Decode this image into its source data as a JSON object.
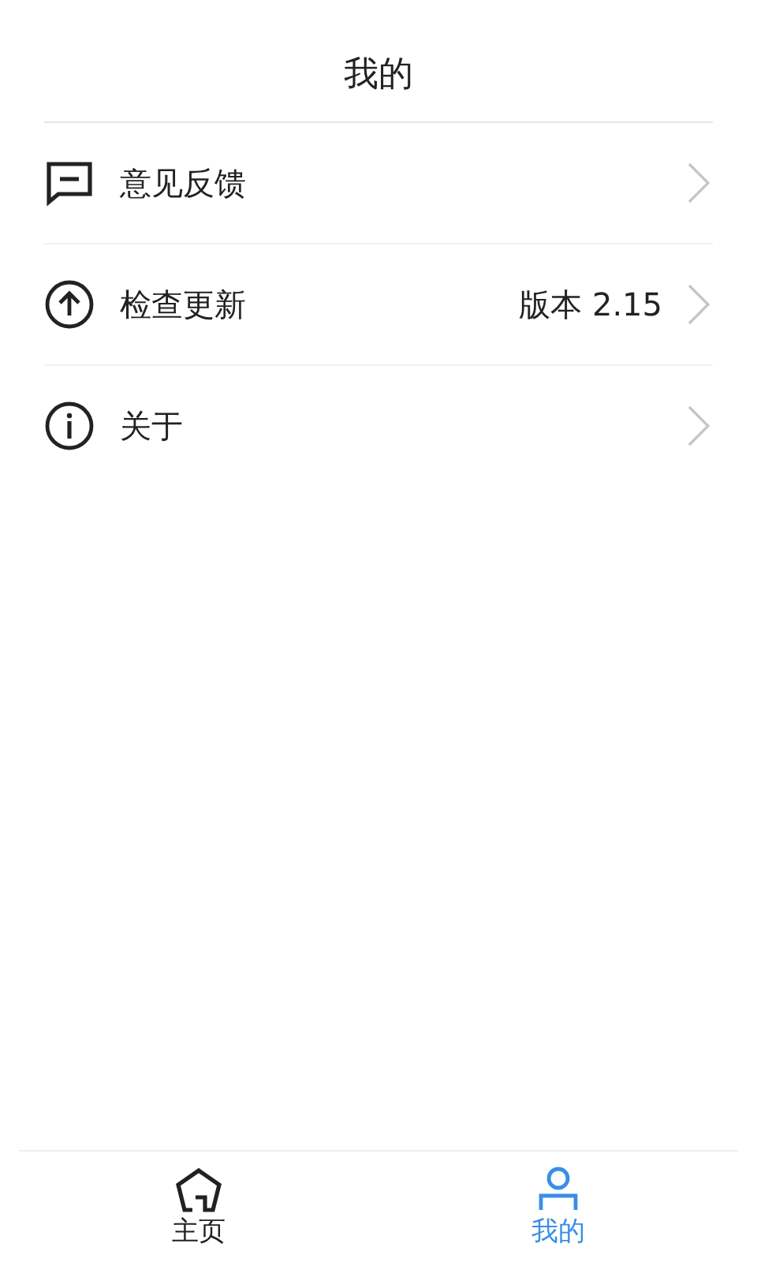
{
  "header": {
    "title": "我的"
  },
  "menu": [
    {
      "kind": "feedback",
      "label": "意见反馈"
    },
    {
      "kind": "update",
      "label": "检查更新",
      "value": "版本 2.15"
    },
    {
      "kind": "info",
      "label": "关于"
    }
  ],
  "tab_bar": [
    {
      "kind": "home",
      "label": "主页",
      "selected": false
    },
    {
      "kind": "profile",
      "label": "我的",
      "selected": true
    }
  ]
}
